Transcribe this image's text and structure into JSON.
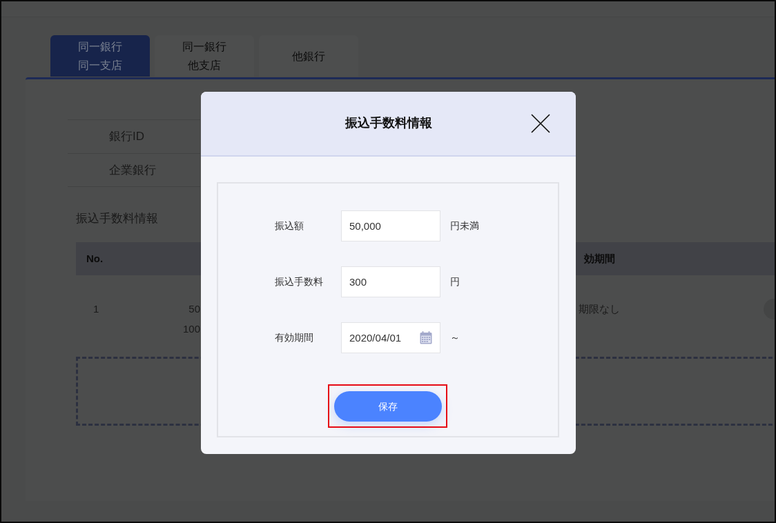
{
  "tabs": [
    {
      "lines": [
        "同一銀行",
        "同一支店"
      ],
      "selected": true
    },
    {
      "lines": [
        "同一銀行",
        "他支店"
      ],
      "selected": false
    },
    {
      "lines": [
        "他銀行"
      ],
      "selected": false
    }
  ],
  "info_rows": [
    {
      "label": "銀行ID"
    },
    {
      "label": "企業銀行"
    }
  ],
  "section_title": "振込手数料情報",
  "fee_table": {
    "header": {
      "no": "No.",
      "validity": "効期間"
    },
    "rows": [
      {
        "no": "1",
        "column_2": [
          "50",
          "100"
        ],
        "validity": "期限なし"
      }
    ]
  },
  "dialog": {
    "title": "振込手数料情報",
    "fields": [
      {
        "label": "振込額",
        "value": "50,000",
        "suffix": "円未満",
        "kind": "text"
      },
      {
        "label": "振込手数料",
        "value": "300",
        "suffix": "円",
        "kind": "text"
      },
      {
        "label": "有効期間",
        "value": "2020/04/01",
        "suffix": "～",
        "kind": "date"
      }
    ],
    "save_button": {
      "label": "保存",
      "highlighted": true
    }
  }
}
